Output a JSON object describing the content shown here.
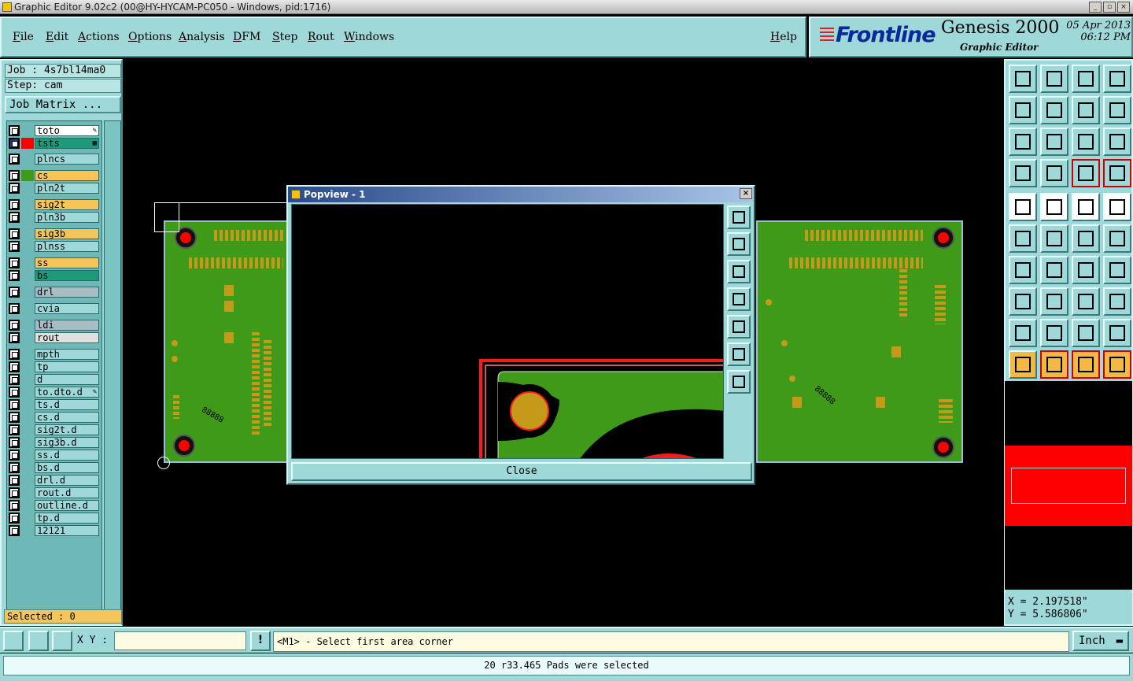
{
  "window": {
    "title": "Graphic Editor 9.02c2 (00@HY-HYCAM-PC050 - Windows, pid:1716)"
  },
  "menu": [
    "File",
    "Edit",
    "Actions",
    "Options",
    "Analysis",
    "DFM",
    "Step",
    "Rout",
    "Windows"
  ],
  "help_label": "Help",
  "brand": {
    "logo": "Frontline",
    "product": "Genesis 2000",
    "subtitle": "Graphic Editor",
    "date": "05 Apr 2013",
    "time": "06:12 PM"
  },
  "job": {
    "job_label": "Job : 4s7bl14ma0",
    "step_label": "Step: cam",
    "matrix_button": "Job Matrix ..."
  },
  "layers": [
    {
      "name": "to",
      "color": "#ffffff",
      "swatch": "",
      "mark": "pen"
    },
    {
      "name": "ts",
      "color": "#1e9a7a",
      "swatch": "#ff0000",
      "mark": "grid",
      "checked": true
    },
    {
      "name": "plncs",
      "color": "#9fd8d8",
      "swatch": ""
    },
    {
      "name": "cs",
      "color": "#f6c55a",
      "swatch": "#3f9a1a"
    },
    {
      "name": "pln2t",
      "color": "#9fd8d8",
      "swatch": ""
    },
    {
      "name": "sig2t",
      "color": "#f6c55a",
      "swatch": ""
    },
    {
      "name": "pln3b",
      "color": "#9fd8d8",
      "swatch": ""
    },
    {
      "name": "sig3b",
      "color": "#f6c55a",
      "swatch": ""
    },
    {
      "name": "plnss",
      "color": "#9fd8d8",
      "swatch": ""
    },
    {
      "name": "ss",
      "color": "#f6c55a",
      "swatch": ""
    },
    {
      "name": "bs",
      "color": "#1e9a7a",
      "swatch": ""
    },
    {
      "name": "drl",
      "color": "#a8bcc4",
      "swatch": ""
    },
    {
      "name": "cvia",
      "color": "#9fd8d8",
      "swatch": ""
    },
    {
      "name": "ldi",
      "color": "#a8bcc4",
      "swatch": ""
    },
    {
      "name": "rout",
      "color": "#e0e0e0",
      "swatch": ""
    },
    {
      "name": "mpth",
      "color": "#9fd8d8",
      "swatch": ""
    },
    {
      "name": "tp",
      "color": "#9fd8d8",
      "swatch": ""
    },
    {
      "name": "d",
      "color": "#9fd8d8",
      "swatch": ""
    },
    {
      "name": "to.d",
      "color": "#9fd8d8",
      "swatch": "",
      "mark": "pen"
    },
    {
      "name": "ts.d",
      "color": "#9fd8d8",
      "swatch": ""
    },
    {
      "name": "cs.d",
      "color": "#9fd8d8",
      "swatch": ""
    },
    {
      "name": "sig2t.d",
      "color": "#9fd8d8",
      "swatch": ""
    },
    {
      "name": "sig3b.d",
      "color": "#9fd8d8",
      "swatch": ""
    },
    {
      "name": "ss.d",
      "color": "#9fd8d8",
      "swatch": ""
    },
    {
      "name": "bs.d",
      "color": "#9fd8d8",
      "swatch": ""
    },
    {
      "name": "drl.d",
      "color": "#9fd8d8",
      "swatch": ""
    },
    {
      "name": "rout.d",
      "color": "#9fd8d8",
      "swatch": ""
    },
    {
      "name": "outline.d",
      "color": "#9fd8d8",
      "swatch": ""
    },
    {
      "name": "tp.d",
      "color": "#9fd8d8",
      "swatch": ""
    },
    {
      "name": "12121",
      "color": "#9fd8d8",
      "swatch": ""
    }
  ],
  "selected_label": "Selected : 0",
  "popup": {
    "title": "Popview - 1",
    "close_label": "Close",
    "close_x": "×"
  },
  "coords": {
    "x": "X = 2.197518\"",
    "y": "Y = 5.586806\""
  },
  "input": {
    "xy_label": "X Y :",
    "xy_value": "",
    "prompt": "<M1> - Select first area corner",
    "units": "Inch"
  },
  "status": "20 r33.465 Pads were selected",
  "board_text": {
    "left_part": "88888",
    "right_part": "88888"
  }
}
